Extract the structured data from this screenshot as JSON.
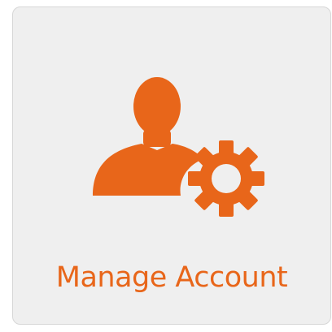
{
  "tile": {
    "label": "Manage Account",
    "icon": "user-gear-icon",
    "accent_color": "#e8661a",
    "background_color": "#efefef",
    "border_color": "#d6d6d6"
  }
}
